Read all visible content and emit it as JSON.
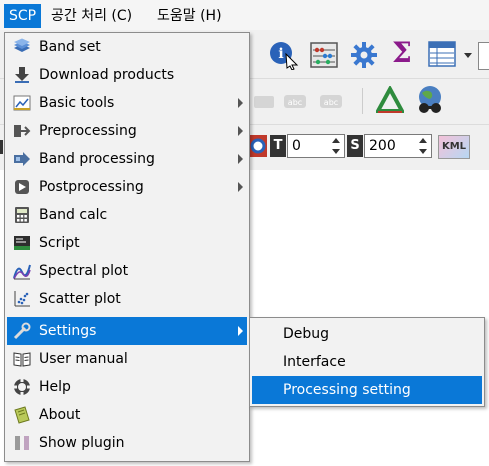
{
  "menubar": {
    "items": [
      "SCP",
      "공간 처리 (C)",
      "도움말 (H)"
    ]
  },
  "toolbar": {
    "t_label": "T",
    "t_value": "0",
    "s_label": "S",
    "s_value": "200",
    "kml_label": "KML"
  },
  "scp_menu": {
    "items": [
      {
        "label": "Band set",
        "icon": "band-set-icon"
      },
      {
        "label": "Download products",
        "icon": "download-icon"
      },
      {
        "label": "Basic tools",
        "icon": "basic-tools-icon"
      },
      {
        "label": "Preprocessing",
        "icon": "preprocessing-icon"
      },
      {
        "label": "Band processing",
        "icon": "band-processing-icon"
      },
      {
        "label": "Postprocessing",
        "icon": "postprocessing-icon"
      },
      {
        "label": "Band calc",
        "icon": "calculator-icon"
      },
      {
        "label": "Script",
        "icon": "script-icon"
      },
      {
        "label": "Spectral plot",
        "icon": "spectral-plot-icon"
      },
      {
        "label": "Scatter plot",
        "icon": "scatter-plot-icon"
      },
      {
        "label": "Settings",
        "icon": "settings-icon"
      },
      {
        "label": "User manual",
        "icon": "manual-icon"
      },
      {
        "label": "Help",
        "icon": "help-icon"
      },
      {
        "label": "About",
        "icon": "about-icon"
      },
      {
        "label": "Show plugin",
        "icon": "show-plugin-icon"
      }
    ]
  },
  "settings_submenu": {
    "items": [
      "Debug",
      "Interface",
      "Processing setting"
    ]
  },
  "colors": {
    "selection": "#0a78d7",
    "menu_bg": "#f2f2f2",
    "sigma": "#8b1a8b"
  }
}
